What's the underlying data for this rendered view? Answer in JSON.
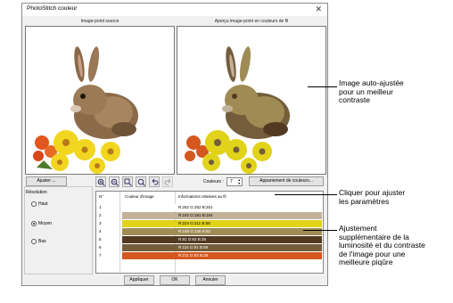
{
  "window": {
    "title": "PhotoStitch couleur"
  },
  "panels": {
    "source_caption": "Image-point source",
    "preview_caption": "Aperçu image-point en couleurs de fil"
  },
  "toolbar": {
    "adjust_label": "Ajuster ...",
    "colors_label": "Couleurs :",
    "colors_value": "7",
    "match_label": "Appariement de couleurs..."
  },
  "resolution": {
    "label": "Résolution",
    "options": [
      {
        "label": "Haut",
        "selected": false
      },
      {
        "label": "Moyen",
        "selected": true
      },
      {
        "label": "Bas",
        "selected": false
      }
    ]
  },
  "table": {
    "headers": {
      "no": "N°",
      "color": "Couleur d'image",
      "info": "Informations relatives au fil"
    },
    "rows": [
      {
        "no": "1",
        "color": "#ffffff",
        "info": "R:252 G:252 B:251"
      },
      {
        "no": "2",
        "color": "#c2b29a",
        "info": "R:192 G:181 B:154"
      },
      {
        "no": "3",
        "color": "#e1d21a",
        "info": "R:224 G:211 B:58"
      },
      {
        "no": "4",
        "color": "#9f8c55",
        "info": "R:159 G:136 B:82"
      },
      {
        "no": "5",
        "color": "#523a22",
        "info": "R:81 G:63 B:35"
      },
      {
        "no": "6",
        "color": "#735d3b",
        "info": "R:115 G:91 B:58"
      },
      {
        "no": "7",
        "color": "#d4571f",
        "info": "R:211 G:83 B:28"
      }
    ]
  },
  "footer": {
    "apply": "Appliquer",
    "ok": "OK",
    "cancel": "Annuler"
  },
  "annotations": {
    "a1": [
      "Image auto-ajustée",
      "pour un meilleur",
      "contraste"
    ],
    "a2": [
      "Cliquer pour ajuster",
      "les paramètres"
    ],
    "a3": [
      "Ajustement",
      "supplémentaire de la",
      "luminosité et du contraste",
      "de l'image pour une",
      "meilleure piqûre"
    ]
  }
}
